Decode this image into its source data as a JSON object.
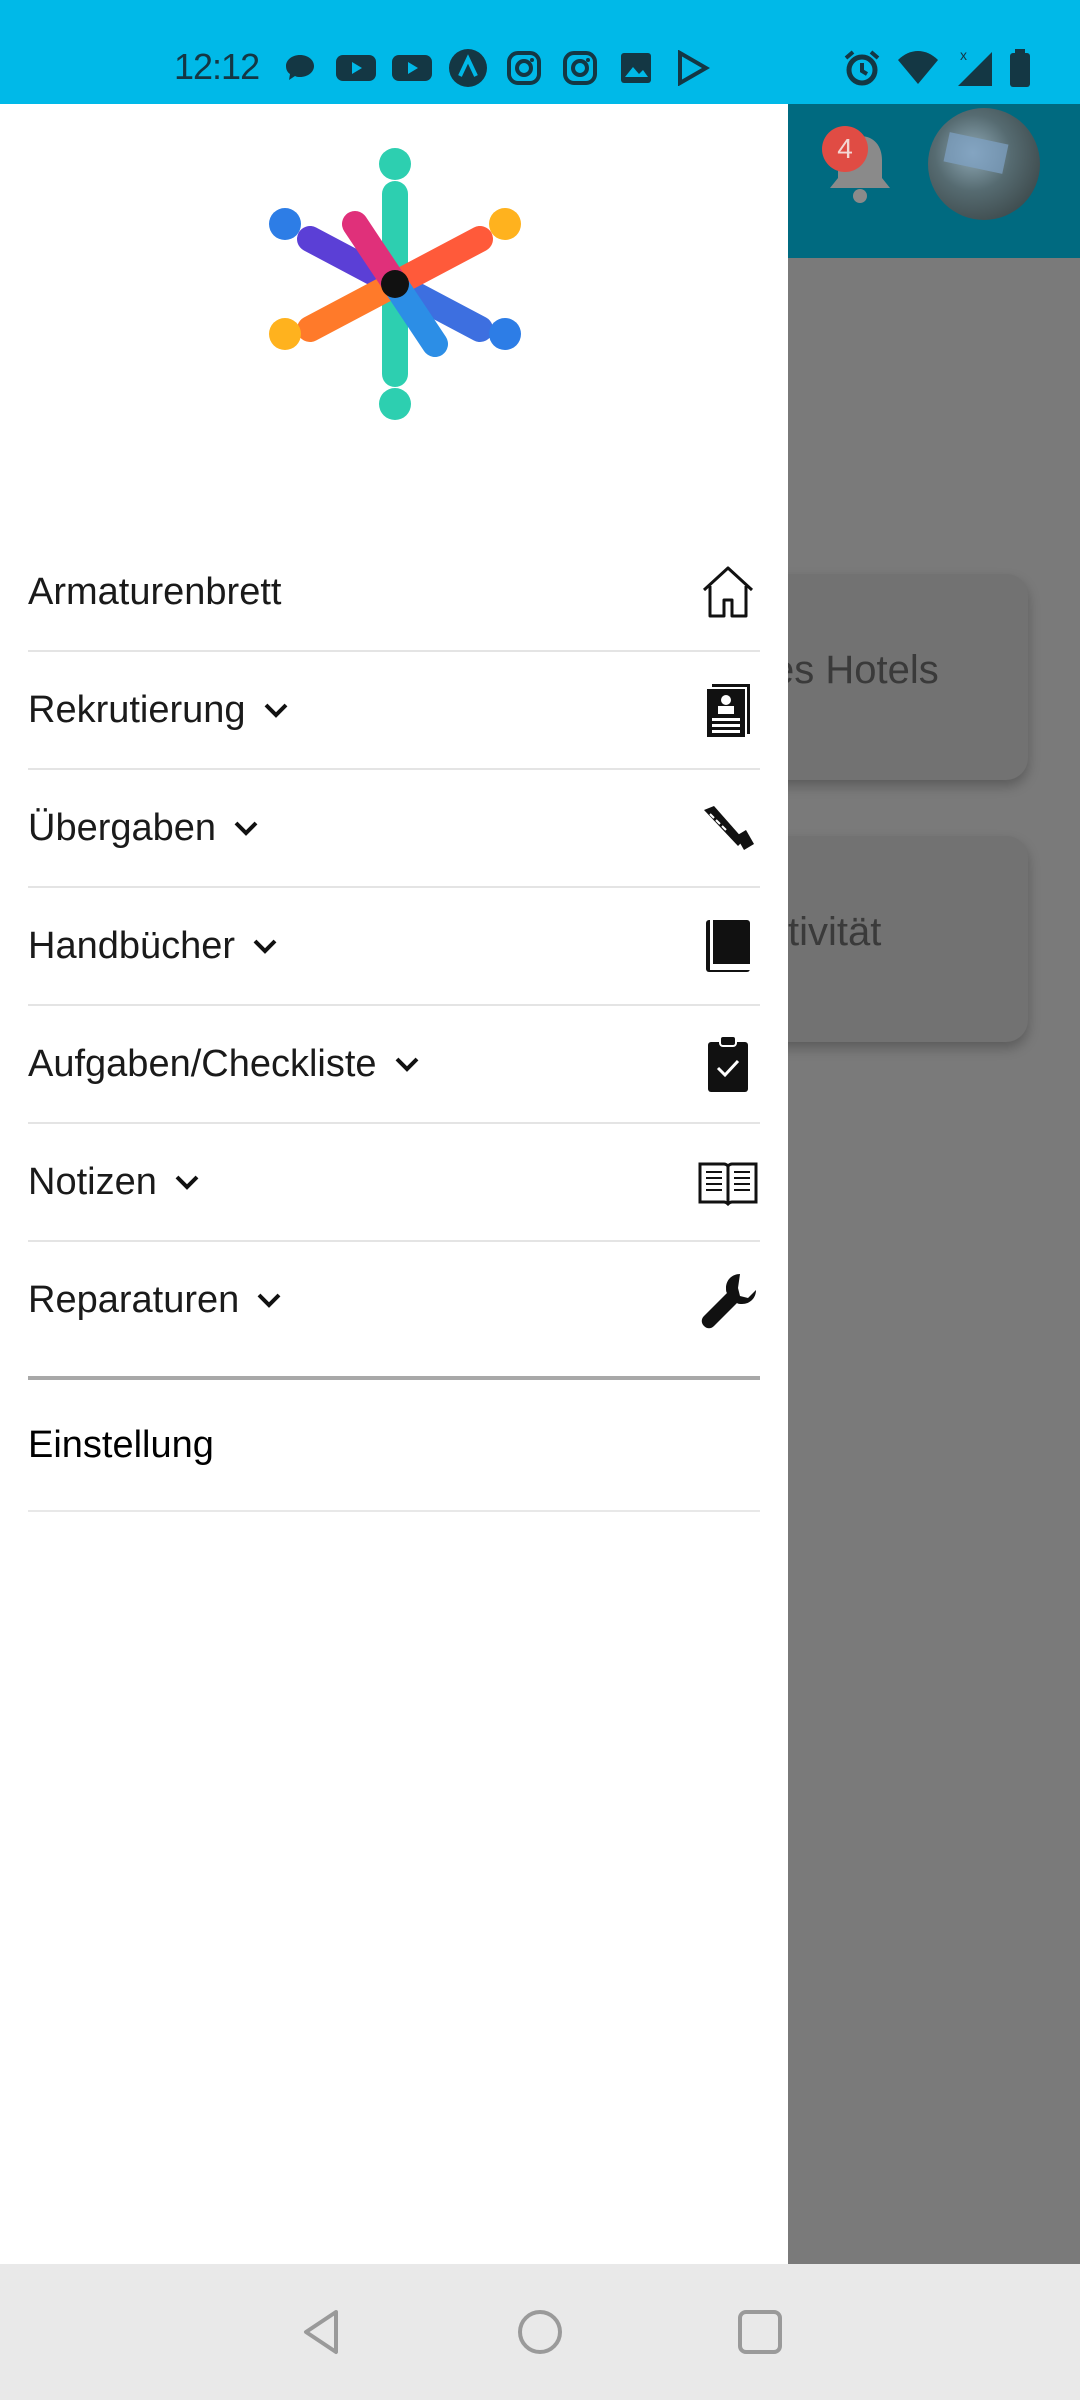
{
  "status": {
    "time": "12:12",
    "icons": [
      "chat-icon",
      "youtube-icon",
      "youtube-icon",
      "arc-icon",
      "instagram-icon",
      "instagram-icon",
      "gallery-icon",
      "play-store-icon"
    ],
    "right_icons": [
      "alarm-icon",
      "wifi-icon",
      "signal-icon",
      "battery-icon"
    ]
  },
  "background": {
    "notification_count": "4",
    "card1_text": "es Hotels",
    "card2_text": "tivität"
  },
  "drawer": {
    "items": [
      {
        "label": "Armaturenbrett",
        "icon": "home-icon",
        "expandable": false
      },
      {
        "label": "Rekrutierung",
        "icon": "resume-icon",
        "expandable": true
      },
      {
        "label": "Übergaben",
        "icon": "handover-icon",
        "expandable": true
      },
      {
        "label": "Handbücher",
        "icon": "book-icon",
        "expandable": true
      },
      {
        "label": "Aufgaben/Checkliste",
        "icon": "clipboard-check-icon",
        "expandable": true
      },
      {
        "label": "Notizen",
        "icon": "open-book-icon",
        "expandable": true
      },
      {
        "label": "Reparaturen",
        "icon": "wrench-icon",
        "expandable": true
      }
    ],
    "settings_label": "Einstellung"
  },
  "colors": {
    "status_bar": "#00b9e8",
    "header": "#006a80",
    "badge": "#e04c44"
  }
}
